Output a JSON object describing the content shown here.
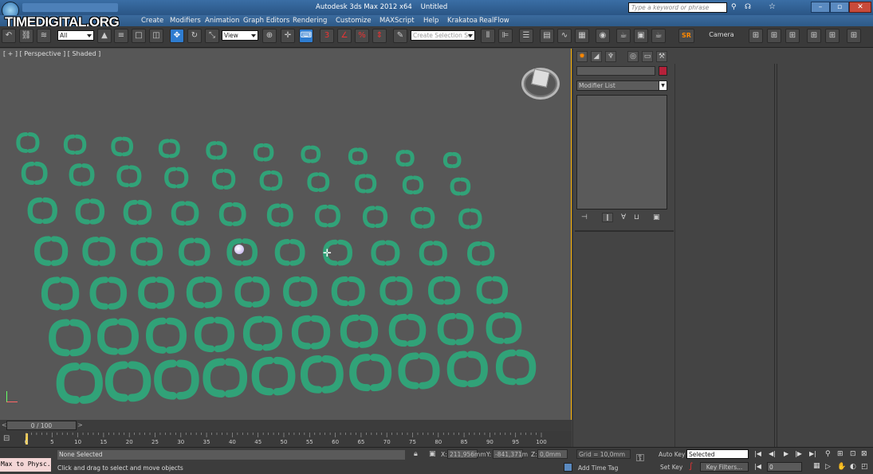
{
  "window": {
    "title": "Autodesk 3ds Max  2012 x64",
    "document": "Untitled",
    "search_placeholder": "Type a keyword or phrase"
  },
  "watermark": "TIMEDIGITAL.ORG",
  "menu": [
    "Create",
    "Modifiers",
    "Animation",
    "Graph Editors",
    "Rendering",
    "Customize",
    "MAXScript",
    "Help",
    "Krakatoa",
    "RealFlow"
  ],
  "toolbar": {
    "filter": "All",
    "ref_coord": "View",
    "selection_set": "Create Selection Se",
    "camera_label": "Camera",
    "sr_label": "SR"
  },
  "viewport": {
    "label": "[ + ] [ Perspective ] [ Shaded ]",
    "object_color": "#2fa77a",
    "grid": {
      "rows": 7,
      "cols": 10
    }
  },
  "command_panel": {
    "modifier_list": "Modifier List",
    "color_swatch": "#b5213a"
  },
  "timeline": {
    "frame": "0 / 100",
    "ticks": [
      "0",
      "5",
      "10",
      "15",
      "20",
      "25",
      "30",
      "35",
      "40",
      "45",
      "50",
      "55",
      "60",
      "65",
      "70",
      "75",
      "80",
      "85",
      "90",
      "95",
      "100"
    ]
  },
  "status": {
    "script_listener": "Max to Physc.",
    "selected": "None Selected",
    "prompt": "Click and drag to select and move objects",
    "x_label": "X:",
    "x_value": "211,956mm",
    "y_label": "Y:",
    "y_value": "-841,371m",
    "z_label": "Z:",
    "z_value": "0,0mm",
    "grid": "Grid = 10,0mm",
    "add_time_tag": "Add Time Tag",
    "auto_key": "Auto Key",
    "set_key": "Set Key",
    "key_mode": "Selected",
    "key_filters": "Key Filters...",
    "frame_value": "0"
  }
}
